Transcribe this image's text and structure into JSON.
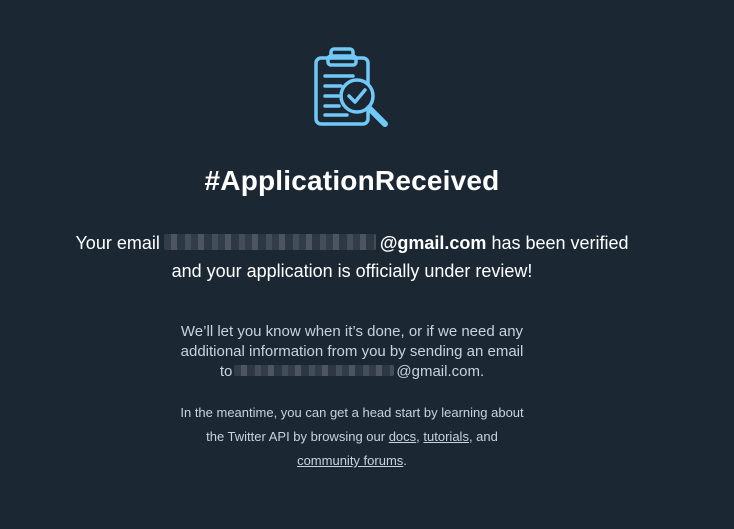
{
  "icon": "clipboard-check-magnifier-icon",
  "colors": {
    "background": "#1b2733",
    "accent": "#71c9f8",
    "primary_text": "#ffffff",
    "secondary_text": "#c8d3dc"
  },
  "title": "#ApplicationReceived",
  "lead": {
    "prefix": "Your email",
    "email_domain": "@gmail.com",
    "suffix": "has been verified",
    "line2": "and your application is officially under review!"
  },
  "notice": {
    "line1": "We’ll let you know when it’s done, or if we need any",
    "line2": "additional information from you by sending an email",
    "to": "to",
    "email_domain": "@gmail.com."
  },
  "meantime": {
    "line1": "In the meantime, you can get a head start by learning about",
    "line2_prefix": "the Twitter API by browsing our",
    "docs_link": "docs",
    "comma": ",",
    "tutorials_link": "tutorials",
    "and": ", and",
    "forums_link": "community forums",
    "period": "."
  }
}
